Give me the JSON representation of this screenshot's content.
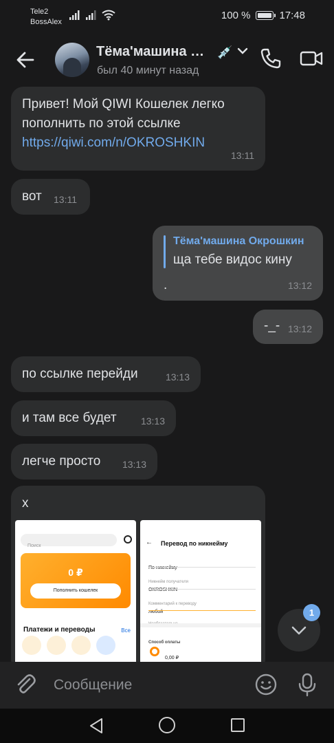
{
  "status_bar": {
    "carrier": "Tele2",
    "operator": "BossAlex",
    "battery": "100 %",
    "time": "17:48"
  },
  "header": {
    "contact_name": "Тёма'машина Окрошкин",
    "last_seen": "был 40 минут назад",
    "emoji": "💉"
  },
  "messages": [
    {
      "direction": "in",
      "text_line1": "Привет! Мой QIWI Кошелек легко",
      "text_line2": "пополнить по этой ссылке",
      "link": "https://qiwi.com/n/OKROSHKIN",
      "time": "13:11"
    },
    {
      "direction": "in",
      "text": "вот",
      "time": "13:11"
    },
    {
      "direction": "out",
      "reply_to_name": "Тёма'машина Окрошкин",
      "reply_to_text": "ща тебе видос кину",
      "text": ".",
      "time": "13:12"
    },
    {
      "direction": "out",
      "text": "-_-",
      "time": "13:12"
    },
    {
      "direction": "in",
      "text": "по ссылке перейди",
      "time": "13:13"
    },
    {
      "direction": "in",
      "text": "и там все будет",
      "time": "13:13"
    },
    {
      "direction": "in",
      "text": "легче просто",
      "time": "13:13"
    },
    {
      "direction": "in",
      "text": "х",
      "attachment_left": {
        "search": "Поиск",
        "balance": "0 ₽",
        "topup": "Пополнить кошелек",
        "section": "Платежи и переводы",
        "all": "Все"
      },
      "attachment_right": {
        "title": "Перевод по никнейму",
        "field1_label": "По никнейму",
        "field2_label": "Никнейм получателя",
        "field2_value": "OKROSHKIN",
        "field3_label": "Комментарий к переводу",
        "field3_value": "любой",
        "field3_hint": "Необязательно",
        "pay_label": "Способ оплаты",
        "pay_value": "0,00 ₽"
      }
    }
  ],
  "scroll_badge": "1",
  "composer": {
    "placeholder": "Сообщение"
  }
}
